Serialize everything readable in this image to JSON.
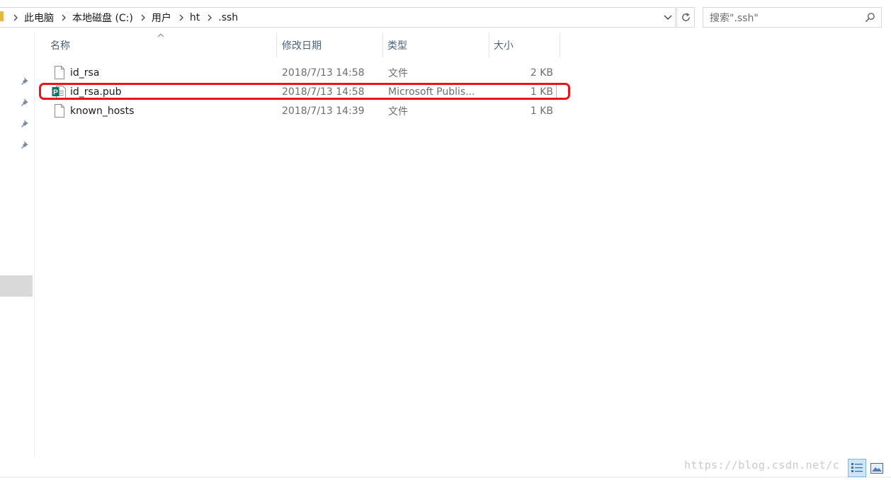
{
  "breadcrumb": {
    "items": [
      "此电脑",
      "本地磁盘 (C:)",
      "用户",
      "ht",
      ".ssh"
    ]
  },
  "search": {
    "placeholder": "搜索\".ssh\""
  },
  "columns": {
    "name": "名称",
    "date": "修改日期",
    "type": "类型",
    "size": "大小"
  },
  "files": [
    {
      "name": "id_rsa",
      "date": "2018/7/13 14:58",
      "type": "文件",
      "size": "2 KB",
      "icon": "blank-file-icon"
    },
    {
      "name": "id_rsa.pub",
      "date": "2018/7/13 14:58",
      "type": "Microsoft Publis...",
      "size": "1 KB",
      "icon": "publisher-file-icon"
    },
    {
      "name": "known_hosts",
      "date": "2018/7/13 14:39",
      "type": "文件",
      "size": "1 KB",
      "icon": "blank-file-icon"
    }
  ],
  "watermark": "https://blog.csdn.net/c",
  "colors": {
    "highlight": "#e8141a",
    "header_text": "#4c607a",
    "publisher_green": "#077568"
  }
}
